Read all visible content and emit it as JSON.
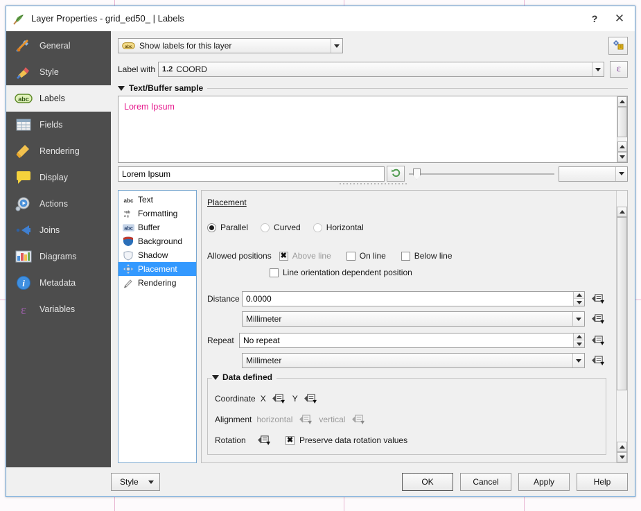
{
  "window": {
    "title": "Layer Properties - grid_ed50_ | Labels",
    "help_label": "?",
    "close_label": "✕"
  },
  "sidebar": {
    "items": [
      {
        "label": "General",
        "icon": "tools-icon",
        "active": false
      },
      {
        "label": "Style",
        "icon": "brush-icon",
        "active": false
      },
      {
        "label": "Labels",
        "icon": "abc-label-icon",
        "active": true
      },
      {
        "label": "Fields",
        "icon": "table-icon",
        "active": false
      },
      {
        "label": "Rendering",
        "icon": "broom-icon",
        "active": false
      },
      {
        "label": "Display",
        "icon": "speech-bubble-icon",
        "active": false
      },
      {
        "label": "Actions",
        "icon": "gear-play-icon",
        "active": false
      },
      {
        "label": "Joins",
        "icon": "join-arrow-icon",
        "active": false
      },
      {
        "label": "Diagrams",
        "icon": "diagram-icon",
        "active": false
      },
      {
        "label": "Metadata",
        "icon": "info-icon",
        "active": false
      },
      {
        "label": "Variables",
        "icon": "epsilon-icon",
        "active": false
      }
    ]
  },
  "top": {
    "mode_combo_value": "Show labels for this layer",
    "mode_combo_icon": "abc-label-icon",
    "auto_placement_button_icon": "automated-placement-icon",
    "label_with_label": "Label with",
    "label_with_value": "COORD",
    "label_with_type_icon": "1.2",
    "expression_button_label": "ε"
  },
  "sample_group": {
    "title": "Text/Buffer sample",
    "preview_text": "Lorem Ipsum",
    "preview_color": "#e61a8d",
    "sample_input_value": "Lorem Ipsum",
    "revert_button_icon": "revert-arrow-icon",
    "zoom_slider_value": 6,
    "scale_combo_value": ""
  },
  "categories": [
    {
      "label": "Text",
      "icon": "abc-text-icon",
      "selected": false
    },
    {
      "label": "Formatting",
      "icon": "formatting-icon",
      "selected": false
    },
    {
      "label": "Buffer",
      "icon": "abc-buffer-icon",
      "selected": false
    },
    {
      "label": "Background",
      "icon": "shield-fill-icon",
      "selected": false
    },
    {
      "label": "Shadow",
      "icon": "shield-shadow-icon",
      "selected": false
    },
    {
      "label": "Placement",
      "icon": "placement-move-icon",
      "selected": true
    },
    {
      "label": "Rendering",
      "icon": "paintbrush-icon",
      "selected": false
    }
  ],
  "placement": {
    "heading": "Placement",
    "modes": [
      {
        "label": "Parallel",
        "checked": true,
        "enabled": true
      },
      {
        "label": "Curved",
        "checked": false,
        "enabled": true
      },
      {
        "label": "Horizontal",
        "checked": false,
        "enabled": true
      }
    ],
    "allowed_positions_label": "Allowed positions",
    "positions": [
      {
        "label": "Above line",
        "checked": true,
        "enabled": false
      },
      {
        "label": "On line",
        "checked": false,
        "enabled": true
      },
      {
        "label": "Below line",
        "checked": false,
        "enabled": true
      }
    ],
    "line_orientation": {
      "label": "Line orientation dependent position",
      "checked": false
    },
    "distance_label": "Distance",
    "distance_value": "0.0000",
    "distance_unit": "Millimeter",
    "repeat_label": "Repeat",
    "repeat_value": "No repeat",
    "repeat_unit": "Millimeter",
    "override_button_icon": "data-defined-override-icon"
  },
  "data_defined": {
    "title": "Data defined",
    "coordinate_label": "Coordinate",
    "coordinate_x_label": "X",
    "coordinate_y_label": "Y",
    "alignment_label": "Alignment",
    "alignment_horizontal_label": "horizontal",
    "alignment_vertical_label": "vertical",
    "rotation_label": "Rotation",
    "preserve_rotation": {
      "label": "Preserve data rotation values",
      "checked": true
    }
  },
  "footer": {
    "style_label": "Style",
    "ok_label": "OK",
    "cancel_label": "Cancel",
    "apply_label": "Apply",
    "help_label": "Help"
  },
  "colors": {
    "sidebar_bg": "#4d4d4d",
    "selection_blue": "#3399ff",
    "window_border": "#5b9bd5",
    "dialog_bg": "#f0f0f0",
    "preview_pink": "#e61a8d",
    "map_grid": "#e8b4d2"
  }
}
